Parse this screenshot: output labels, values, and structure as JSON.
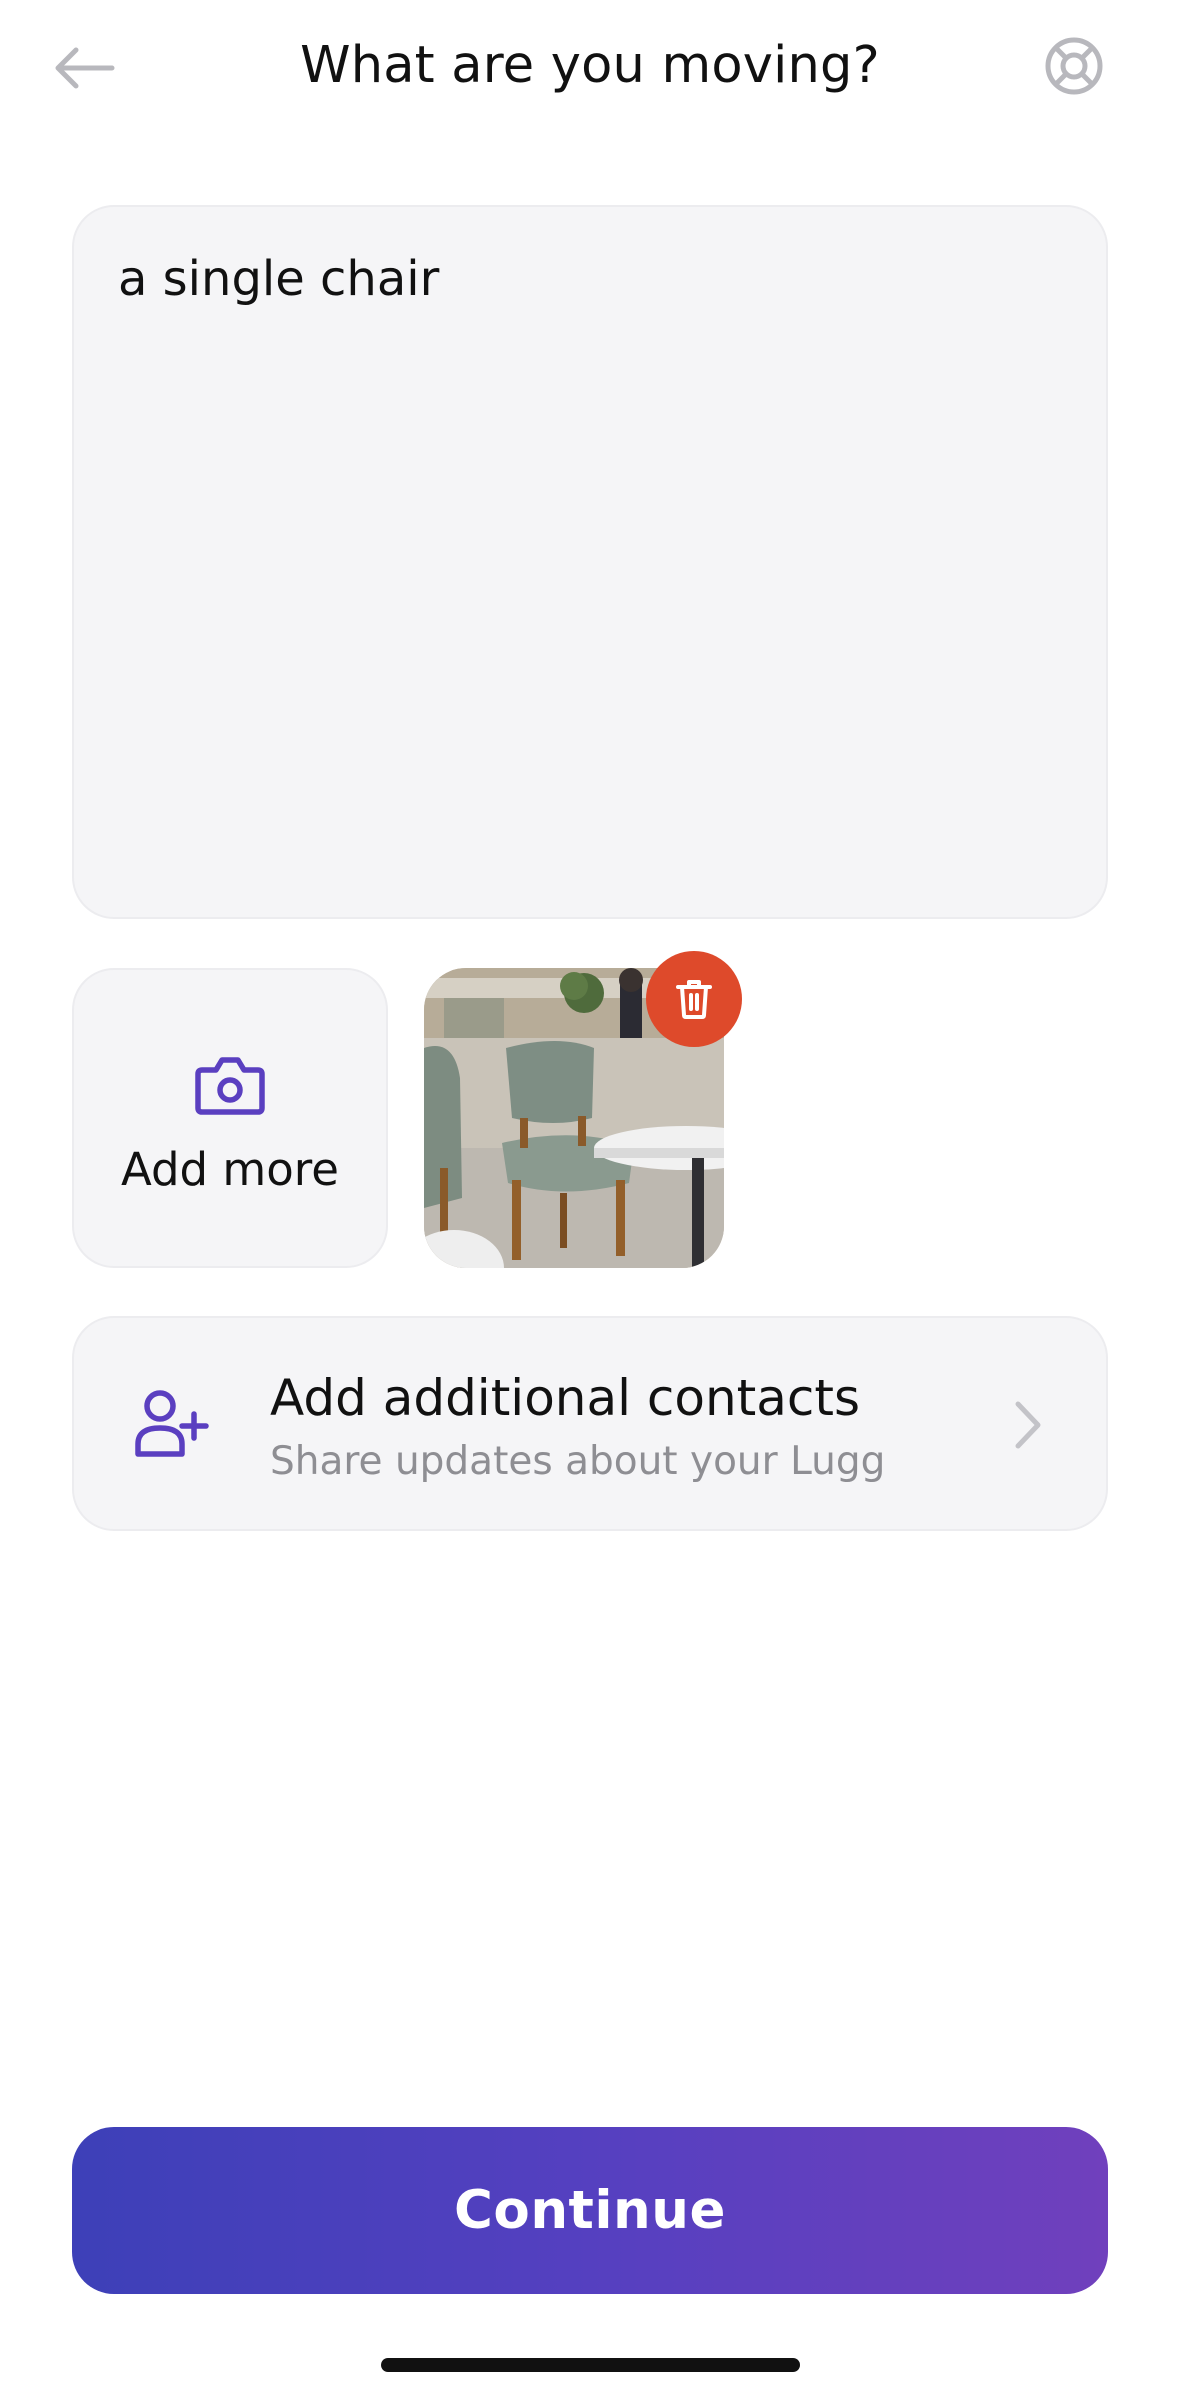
{
  "header": {
    "title": "What are you moving?",
    "back_icon": "arrow-left-icon",
    "help_icon": "lifebuoy-icon"
  },
  "description": {
    "value": "a single chair"
  },
  "photos": {
    "add_more_label": "Add more",
    "add_more_icon": "camera-icon",
    "delete_icon": "trash-icon",
    "thumbnail_subject": "chair-photo"
  },
  "contacts": {
    "title": "Add additional contacts",
    "subtitle": "Share updates about your Lugg",
    "icon": "add-person-icon",
    "chevron_icon": "chevron-right-icon"
  },
  "footer": {
    "continue_label": "Continue"
  },
  "colors": {
    "accent": "#5a3fc0",
    "button_gradient_start": "#3d40b8",
    "button_gradient_end": "#7040bd",
    "delete": "#de4a2b",
    "card_background": "#f5f5f7",
    "muted_text": "#8e8e93"
  }
}
